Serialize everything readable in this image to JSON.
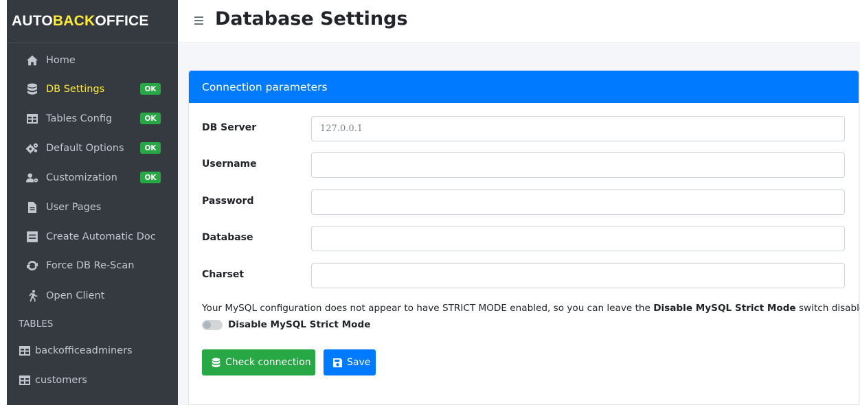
{
  "brand": {
    "part1": "AUTO",
    "part2": "BACK",
    "part3": "OFFICE",
    "colors": {
      "white": "#ffffff",
      "yellow": "#ffeb3b"
    }
  },
  "header": {
    "title": "Database Settings"
  },
  "sidebar": {
    "items": [
      {
        "label": "Home",
        "icon": "home-icon"
      },
      {
        "label": "DB Settings",
        "icon": "database-icon",
        "badge": "OK",
        "active": true
      },
      {
        "label": "Tables Config",
        "icon": "table-icon",
        "badge": "OK"
      },
      {
        "label": "Default Options",
        "icon": "gears-icon",
        "badge": "OK"
      },
      {
        "label": "Customization",
        "icon": "user-cog-icon",
        "badge": "OK"
      },
      {
        "label": "User Pages",
        "icon": "file-icon"
      },
      {
        "label": "Create Automatic Doc",
        "icon": "document-icon"
      },
      {
        "label": "Force DB Re-Scan",
        "icon": "sync-icon"
      },
      {
        "label": "Open Client",
        "icon": "running-icon"
      }
    ],
    "tables_header": "TABLES",
    "tables": [
      {
        "label": "backofficeadminers",
        "icon": "table-icon"
      },
      {
        "label": "customers",
        "icon": "table-icon"
      }
    ]
  },
  "card": {
    "title": "Connection parameters",
    "fields": [
      {
        "label": "DB Server",
        "placeholder": "127.0.0.1",
        "value": ""
      },
      {
        "label": "Username",
        "placeholder": "",
        "value": ""
      },
      {
        "label": "Password",
        "placeholder": "",
        "value": ""
      },
      {
        "label": "Database",
        "placeholder": "",
        "value": ""
      },
      {
        "label": "Charset",
        "placeholder": "",
        "value": ""
      }
    ],
    "note_prefix": "Your MySQL configuration does not appear to have STRICT MODE enabled, so you can leave the ",
    "note_bold": "Disable MySQL Strict Mode",
    "note_suffix": " switch disabled.",
    "switch_label": "Disable MySQL Strict Mode",
    "switch_on": false,
    "check_button": "Check connection",
    "save_button": "Save"
  },
  "colors": {
    "primary": "#007bff",
    "success": "#28a745",
    "sidebar_bg": "#343a40",
    "active_text": "#ffeb3b"
  }
}
